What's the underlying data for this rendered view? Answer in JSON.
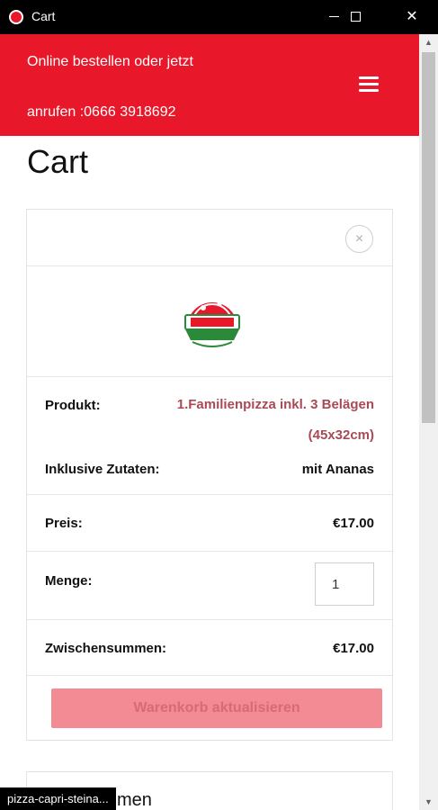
{
  "window": {
    "title": "Cart",
    "minimize_glyph": "",
    "maximize_glyph": "",
    "close_glyph": "✕"
  },
  "header": {
    "line1": "Online bestellen oder jetzt",
    "line2": "anrufen :0666 3918692"
  },
  "page_title": "Cart",
  "cart": {
    "remove_glyph": "×",
    "product_label": "Produkt:",
    "product_name": "1.Familienpizza inkl. 3 Belägen (45x32cm)",
    "ingredients_label": "Inklusive Zutaten:",
    "ingredients_value": "mit Ananas",
    "price_label": "Preis:",
    "price_value": "€17.00",
    "quantity_label": "Menge:",
    "quantity_value": "1",
    "subtotal_label": "Zwischensummen:",
    "subtotal_value": "€17.00",
    "update_button": "Warenkorb aktualisieren"
  },
  "totals_partial_title": "men",
  "status_url": "pizza-capri-steina...",
  "scrollbar": {
    "up_glyph": "▲",
    "down_glyph": "▼"
  },
  "colors": {
    "brand_red": "#e8182a",
    "product_link": "#a84a55",
    "update_button_bg": "#f28b93"
  },
  "icons": {
    "menu": "hamburger-icon",
    "remove": "close-circle-icon",
    "product": "pizza-capri-logo"
  }
}
